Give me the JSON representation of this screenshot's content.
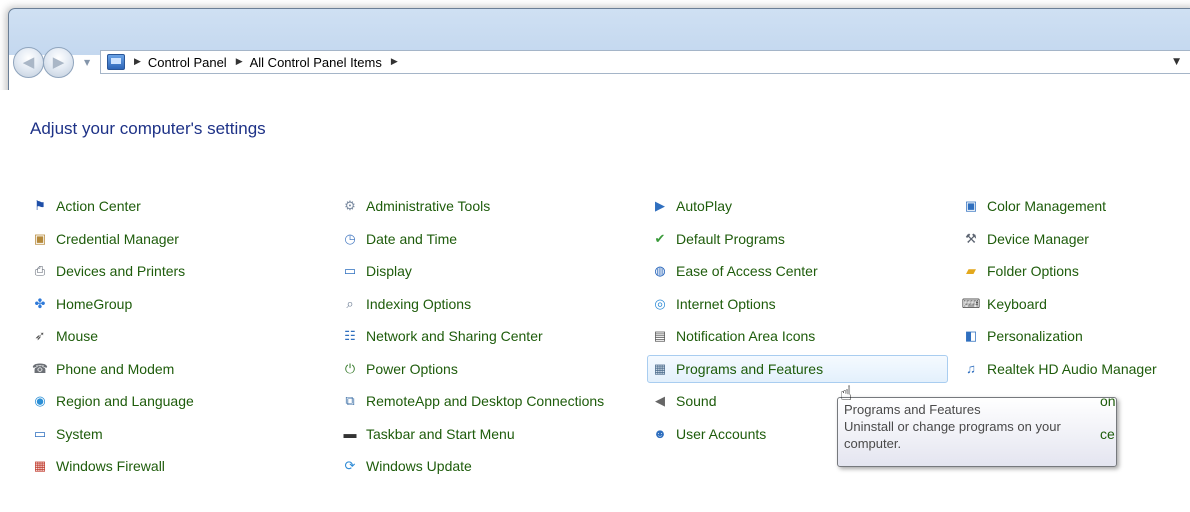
{
  "navigation": {
    "back_icon": "back-arrow-icon",
    "forward_icon": "forward-arrow-icon",
    "breadcrumbs": [
      "Control Panel",
      "All Control Panel Items"
    ]
  },
  "page": {
    "title": "Adjust your computer's settings"
  },
  "items": [
    {
      "label": "Action Center",
      "icon": "flag-icon",
      "color": "#1f4fa8"
    },
    {
      "label": "Credential Manager",
      "icon": "vault-icon",
      "color": "#b5893a"
    },
    {
      "label": "Devices and Printers",
      "icon": "printer-icon",
      "color": "#5b6370"
    },
    {
      "label": "HomeGroup",
      "icon": "homegroup-icon",
      "color": "#2f7ad9"
    },
    {
      "label": "Mouse",
      "icon": "mouse-icon",
      "color": "#555555"
    },
    {
      "label": "Phone and Modem",
      "icon": "phone-icon",
      "color": "#6b6f75"
    },
    {
      "label": "Region and Language",
      "icon": "globe-icon",
      "color": "#2b8fd6"
    },
    {
      "label": "System",
      "icon": "computer-icon",
      "color": "#2f6fbf"
    },
    {
      "label": "Windows Firewall",
      "icon": "firewall-icon",
      "color": "#c0392b"
    },
    {
      "label": "Administrative Tools",
      "icon": "tools-icon",
      "color": "#7a8aa0"
    },
    {
      "label": "Date and Time",
      "icon": "clock-icon",
      "color": "#4d7fc4"
    },
    {
      "label": "Display",
      "icon": "monitor-icon",
      "color": "#2f6fbf"
    },
    {
      "label": "Indexing Options",
      "icon": "magnifier-icon",
      "color": "#6b7c93"
    },
    {
      "label": "Network and Sharing Center",
      "icon": "network-icon",
      "color": "#2f6fbf"
    },
    {
      "label": "Power Options",
      "icon": "power-icon",
      "color": "#3a7d2f"
    },
    {
      "label": "RemoteApp and Desktop Connections",
      "icon": "remote-desktop-icon",
      "color": "#3b6ea5"
    },
    {
      "label": "Taskbar and Start Menu",
      "icon": "taskbar-icon",
      "color": "#333333"
    },
    {
      "label": "Windows Update",
      "icon": "windows-update-icon",
      "color": "#2e8bd6"
    },
    {
      "label": "AutoPlay",
      "icon": "autoplay-icon",
      "color": "#2f6fbf"
    },
    {
      "label": "Default Programs",
      "icon": "default-programs-icon",
      "color": "#3a9a3a"
    },
    {
      "label": "Ease of Access Center",
      "icon": "ease-of-access-icon",
      "color": "#1f5fb8"
    },
    {
      "label": "Internet Options",
      "icon": "internet-icon",
      "color": "#2e8bd6"
    },
    {
      "label": "Notification Area Icons",
      "icon": "notification-icon",
      "color": "#555555"
    },
    {
      "label": "Programs and Features",
      "icon": "programs-icon",
      "color": "#4a6a8a"
    },
    {
      "label": "Sound",
      "icon": "speaker-icon",
      "color": "#666666"
    },
    {
      "label": "User Accounts",
      "icon": "users-icon",
      "color": "#2f6fbf"
    },
    {
      "label": "Color Management",
      "icon": "color-monitor-icon",
      "color": "#2f6fbf"
    },
    {
      "label": "Device Manager",
      "icon": "device-manager-icon",
      "color": "#5b6370"
    },
    {
      "label": "Folder Options",
      "icon": "folder-icon",
      "color": "#e3a81d"
    },
    {
      "label": "Keyboard",
      "icon": "keyboard-icon",
      "color": "#555555"
    },
    {
      "label": "Personalization",
      "icon": "personalization-icon",
      "color": "#2f6fbf"
    },
    {
      "label": "Realtek HD Audio Manager",
      "icon": "audio-manager-icon",
      "color": "#2f6fbf"
    },
    {
      "label": "on",
      "icon": "",
      "color": ""
    },
    {
      "label": "ce",
      "icon": "",
      "color": ""
    }
  ],
  "hovered_item": "Programs and Features",
  "tooltip": {
    "title": "Programs and Features",
    "description_line1": "Uninstall or change programs on your",
    "description_line2": "computer."
  },
  "colors": {
    "link": "#1e5c0b",
    "title": "#1e3287"
  }
}
